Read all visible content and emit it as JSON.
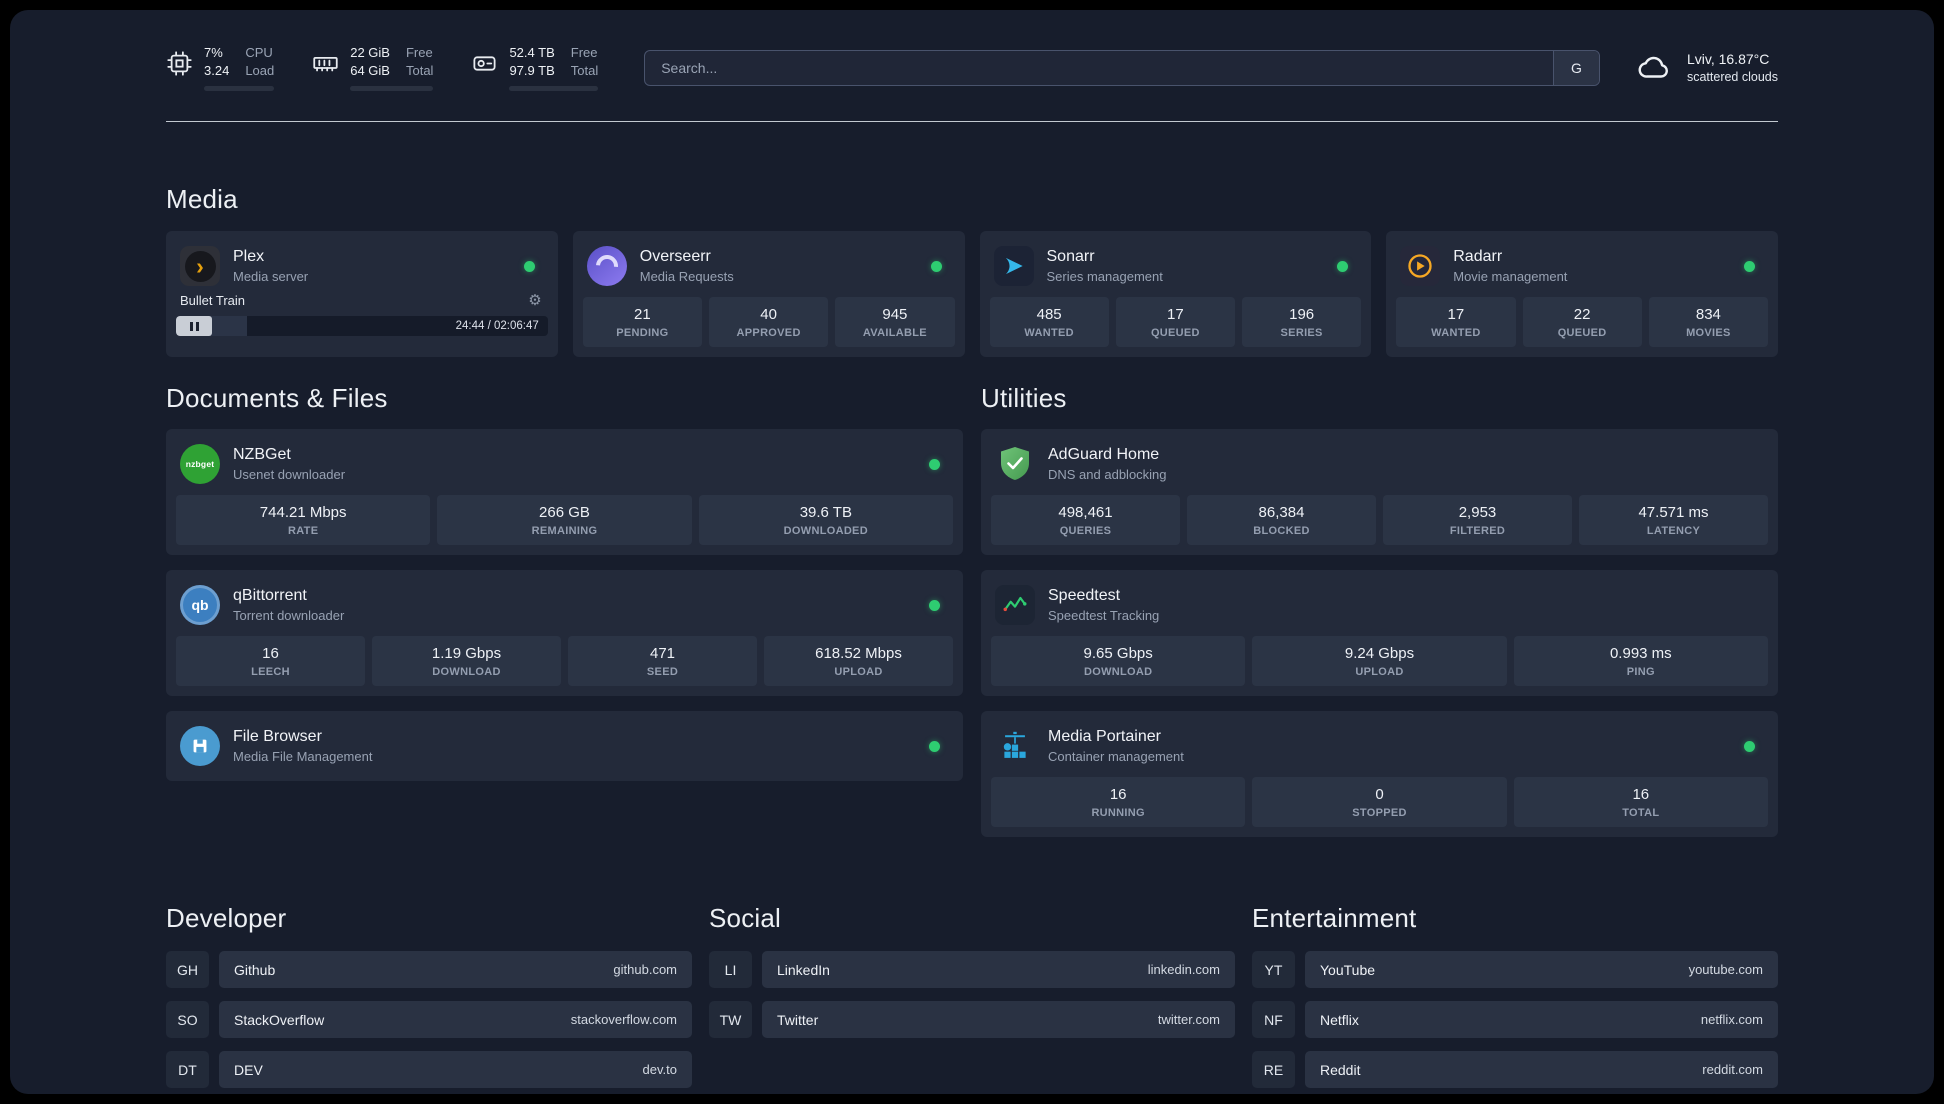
{
  "colors": {
    "background": "#171d2c",
    "card": "#232a3a",
    "stat_tile": "#2b3445",
    "status_ok": "#2ecc71",
    "plex_accent": "#e5a00d",
    "adguard_green": "#57b35f",
    "portainer_blue": "#2aa7dd"
  },
  "header": {
    "cpu": {
      "value_top": "7%",
      "value_bottom": "3.24",
      "label_top": "CPU",
      "label_bottom": "Load",
      "fill_style": "width:38%"
    },
    "ram": {
      "value_top": "22 GiB",
      "value_bottom": "64 GiB",
      "label_top": "Free",
      "label_bottom": "Total",
      "fill_style": "width:45%"
    },
    "disk": {
      "value_top": "52.4 TB",
      "value_bottom": "97.9 TB",
      "label_top": "Free",
      "label_bottom": "Total",
      "fill_style": "width:55%"
    },
    "search": {
      "placeholder": "Search...",
      "button_label": "G"
    },
    "weather": {
      "location": "Lviv, 16.87°C",
      "condition": "scattered clouds"
    }
  },
  "media": {
    "title": "Media",
    "plex": {
      "name": "Plex",
      "desc": "Media server",
      "glyph": "›",
      "gear_glyph": "⚙",
      "now_playing": {
        "title": "Bullet Train",
        "time": "24:44 / 02:06:47",
        "progress_style": "width:19%"
      }
    },
    "overseerr": {
      "name": "Overseerr",
      "desc": "Media Requests",
      "stats": [
        {
          "value": "21",
          "label": "PENDING"
        },
        {
          "value": "40",
          "label": "APPROVED"
        },
        {
          "value": "945",
          "label": "AVAILABLE"
        }
      ]
    },
    "sonarr": {
      "name": "Sonarr",
      "desc": "Series management",
      "stats": [
        {
          "value": "485",
          "label": "WANTED"
        },
        {
          "value": "17",
          "label": "QUEUED"
        },
        {
          "value": "196",
          "label": "SERIES"
        }
      ]
    },
    "radarr": {
      "name": "Radarr",
      "desc": "Movie management",
      "stats": [
        {
          "value": "17",
          "label": "WANTED"
        },
        {
          "value": "22",
          "label": "QUEUED"
        },
        {
          "value": "834",
          "label": "MOVIES"
        }
      ]
    }
  },
  "documents": {
    "title": "Documents & Files",
    "nzbget": {
      "name": "NZBGet",
      "desc": "Usenet downloader",
      "icon_text": "nzbget",
      "stats": [
        {
          "value": "744.21 Mbps",
          "label": "RATE"
        },
        {
          "value": "266 GB",
          "label": "REMAINING"
        },
        {
          "value": "39.6 TB",
          "label": "DOWNLOADED"
        }
      ]
    },
    "qbittorrent": {
      "name": "qBittorrent",
      "desc": "Torrent downloader",
      "icon_text": "qb",
      "stats": [
        {
          "value": "16",
          "label": "LEECH"
        },
        {
          "value": "1.19 Gbps",
          "label": "DOWNLOAD"
        },
        {
          "value": "471",
          "label": "SEED"
        },
        {
          "value": "618.52 Mbps",
          "label": "UPLOAD"
        }
      ]
    },
    "filebrowser": {
      "name": "File Browser",
      "desc": "Media File Management"
    }
  },
  "utilities": {
    "title": "Utilities",
    "adguard": {
      "name": "AdGuard Home",
      "desc": "DNS and adblocking",
      "stats": [
        {
          "value": "498,461",
          "label": "QUERIES"
        },
        {
          "value": "86,384",
          "label": "BLOCKED"
        },
        {
          "value": "2,953",
          "label": "FILTERED"
        },
        {
          "value": "47.571 ms",
          "label": "LATENCY"
        }
      ]
    },
    "speedtest": {
      "name": "Speedtest",
      "desc": "Speedtest Tracking",
      "stats": [
        {
          "value": "9.65 Gbps",
          "label": "DOWNLOAD"
        },
        {
          "value": "9.24 Gbps",
          "label": "UPLOAD"
        },
        {
          "value": "0.993 ms",
          "label": "PING"
        }
      ]
    },
    "portainer": {
      "name": "Media Portainer",
      "desc": "Container management",
      "stats": [
        {
          "value": "16",
          "label": "RUNNING"
        },
        {
          "value": "0",
          "label": "STOPPED"
        },
        {
          "value": "16",
          "label": "TOTAL"
        }
      ]
    }
  },
  "bookmarks": [
    {
      "title": "Developer",
      "items": [
        {
          "abbr": "GH",
          "name": "Github",
          "url": "github.com"
        },
        {
          "abbr": "SO",
          "name": "StackOverflow",
          "url": "stackoverflow.com"
        },
        {
          "abbr": "DT",
          "name": "DEV",
          "url": "dev.to"
        }
      ]
    },
    {
      "title": "Social",
      "items": [
        {
          "abbr": "LI",
          "name": "LinkedIn",
          "url": "linkedin.com"
        },
        {
          "abbr": "TW",
          "name": "Twitter",
          "url": "twitter.com"
        }
      ]
    },
    {
      "title": "Entertainment",
      "items": [
        {
          "abbr": "YT",
          "name": "YouTube",
          "url": "youtube.com"
        },
        {
          "abbr": "NF",
          "name": "Netflix",
          "url": "netflix.com"
        },
        {
          "abbr": "RE",
          "name": "Reddit",
          "url": "reddit.com"
        }
      ]
    }
  ]
}
